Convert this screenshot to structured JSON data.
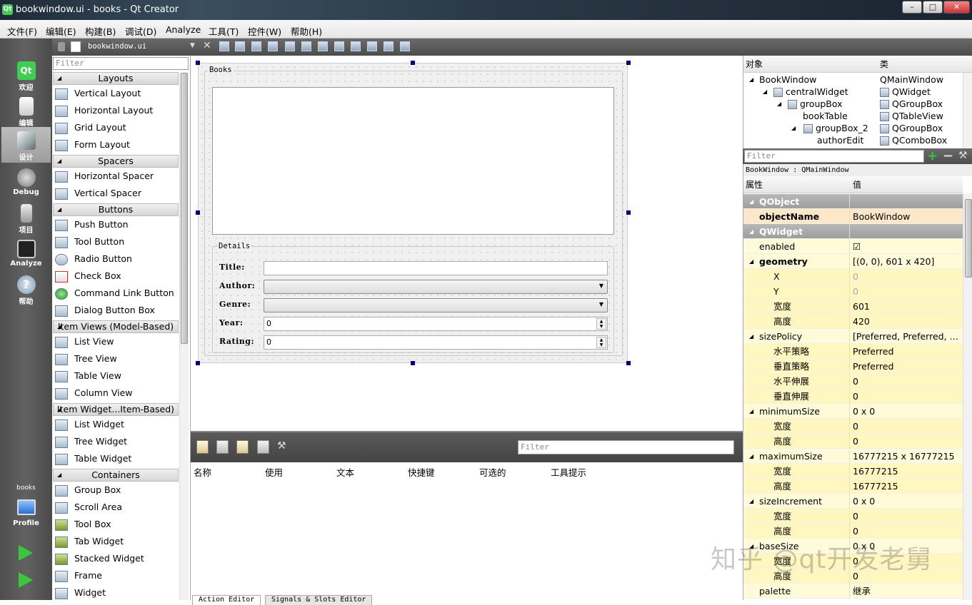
{
  "window": {
    "title": "bookwindow.ui - books - Qt Creator",
    "controls": [
      "–",
      "□",
      "✕"
    ]
  },
  "menubar": [
    "文件(F)",
    "编辑(E)",
    "构建(B)",
    "调试(D)",
    "Analyze",
    "工具(T)",
    "控件(W)",
    "帮助(H)"
  ],
  "modes": [
    {
      "label": "欢迎",
      "icon": "qt-welcome-icon"
    },
    {
      "label": "编辑",
      "icon": "edit-document-icon"
    },
    {
      "label": "设计",
      "icon": "design-pencil-icon"
    },
    {
      "label": "Debug",
      "icon": "debug-bug-icon"
    },
    {
      "label": "项目",
      "icon": "project-wrench-icon"
    },
    {
      "label": "Analyze",
      "icon": "analyze-monitor-icon"
    },
    {
      "label": "帮助",
      "icon": "help-question-icon"
    }
  ],
  "project_selector": {
    "project": "books",
    "config": "Profile"
  },
  "editor": {
    "document": "bookwindow.ui"
  },
  "widgetbox": {
    "filter_placeholder": "Filter",
    "categories": [
      {
        "name": "Layouts",
        "top": 0,
        "items": [
          "Vertical Layout",
          "Horizontal Layout",
          "Grid Layout",
          "Form Layout"
        ]
      },
      {
        "name": "Spacers",
        "items": [
          "Horizontal Spacer",
          "Vertical Spacer"
        ]
      },
      {
        "name": "Buttons",
        "items": [
          "Push Button",
          "Tool Button",
          "Radio Button",
          "Check Box",
          "Command Link Button",
          "Dialog Button Box"
        ]
      },
      {
        "name": "Item Views (Model-Based)",
        "items": [
          "List View",
          "Tree View",
          "Table View",
          "Column View"
        ]
      },
      {
        "name": "Item Widget...Item-Based)",
        "items": [
          "List Widget",
          "Tree Widget",
          "Table Widget"
        ]
      },
      {
        "name": "Containers",
        "items": [
          "Group Box",
          "Scroll Area",
          "Tool Box",
          "Tab Widget",
          "Stacked Widget",
          "Frame",
          "Widget"
        ]
      }
    ]
  },
  "form": {
    "books_group_title": "Books",
    "details_group_title": "Details",
    "fields": {
      "title_label": "Title:",
      "author_label": "Author:",
      "genre_label": "Genre:",
      "year_label": "Year:",
      "year_value": "0",
      "rating_label": "Rating:",
      "rating_value": "0"
    }
  },
  "action_editor": {
    "filter_placeholder": "Filter",
    "columns": [
      "名称",
      "使用",
      "文本",
      "快捷键",
      "可选的",
      "工具提示"
    ],
    "tabs": [
      "Action Editor",
      "Signals & Slots Editor"
    ]
  },
  "object_inspector": {
    "headers": [
      "对象",
      "类"
    ],
    "rows": [
      {
        "name": "BookWindow",
        "class": "QMainWindow",
        "depth": 0,
        "expanded": true
      },
      {
        "name": "centralWidget",
        "class": "QWidget",
        "depth": 1,
        "expanded": true
      },
      {
        "name": "groupBox",
        "class": "QGroupBox",
        "depth": 2,
        "expanded": true
      },
      {
        "name": "bookTable",
        "class": "QTableView",
        "depth": 3,
        "expanded": false
      },
      {
        "name": "groupBox_2",
        "class": "QGroupBox",
        "depth": 3,
        "expanded": true
      },
      {
        "name": "authorEdit",
        "class": "QComboBox",
        "depth": 4,
        "expanded": false
      }
    ],
    "filter_placeholder": "Filter"
  },
  "property_editor": {
    "class_line": "BookWindow : QMainWindow",
    "headers": [
      "属性",
      "值"
    ],
    "rows": [
      {
        "name": "QObject",
        "value": "",
        "type": "group"
      },
      {
        "name": "objectName",
        "value": "BookWindow",
        "type": "o1",
        "bold": true
      },
      {
        "name": "QWidget",
        "value": "",
        "type": "group"
      },
      {
        "name": "enabled",
        "value": "☑",
        "type": "y1"
      },
      {
        "name": "geometry",
        "value": "[(0, 0), 601 x 420]",
        "type": "y1",
        "bold": true,
        "tri": true
      },
      {
        "name": "X",
        "value": "0",
        "type": "y2",
        "sub": true,
        "dim": true
      },
      {
        "name": "Y",
        "value": "0",
        "type": "y2",
        "sub": true,
        "dim": true
      },
      {
        "name": "宽度",
        "value": "601",
        "type": "y2",
        "sub": true
      },
      {
        "name": "高度",
        "value": "420",
        "type": "y2",
        "sub": true
      },
      {
        "name": "sizePolicy",
        "value": "[Preferred, Preferred, 0,...",
        "type": "y1",
        "tri": true
      },
      {
        "name": "水平策略",
        "value": "Preferred",
        "type": "y2",
        "sub": true
      },
      {
        "name": "垂直策略",
        "value": "Preferred",
        "type": "y2",
        "sub": true
      },
      {
        "name": "水平伸展",
        "value": "0",
        "type": "y2",
        "sub": true
      },
      {
        "name": "垂直伸展",
        "value": "0",
        "type": "y2",
        "sub": true
      },
      {
        "name": "minimumSize",
        "value": "0 x 0",
        "type": "y1",
        "tri": true
      },
      {
        "name": "宽度",
        "value": "0",
        "type": "y2",
        "sub": true
      },
      {
        "name": "高度",
        "value": "0",
        "type": "y2",
        "sub": true
      },
      {
        "name": "maximumSize",
        "value": "16777215 x 16777215",
        "type": "y1",
        "tri": true
      },
      {
        "name": "宽度",
        "value": "16777215",
        "type": "y2",
        "sub": true
      },
      {
        "name": "高度",
        "value": "16777215",
        "type": "y2",
        "sub": true
      },
      {
        "name": "sizeIncrement",
        "value": "0 x 0",
        "type": "y1",
        "tri": true
      },
      {
        "name": "宽度",
        "value": "0",
        "type": "y2",
        "sub": true
      },
      {
        "name": "高度",
        "value": "0",
        "type": "y2",
        "sub": true
      },
      {
        "name": "baseSize",
        "value": "0 x 0",
        "type": "y1",
        "tri": true
      },
      {
        "name": "宽度",
        "value": "0",
        "type": "y2",
        "sub": true
      },
      {
        "name": "高度",
        "value": "0",
        "type": "y2",
        "sub": true
      },
      {
        "name": "palette",
        "value": "继承",
        "type": "y1"
      }
    ]
  },
  "watermark": "知乎 @qt开发老舅"
}
